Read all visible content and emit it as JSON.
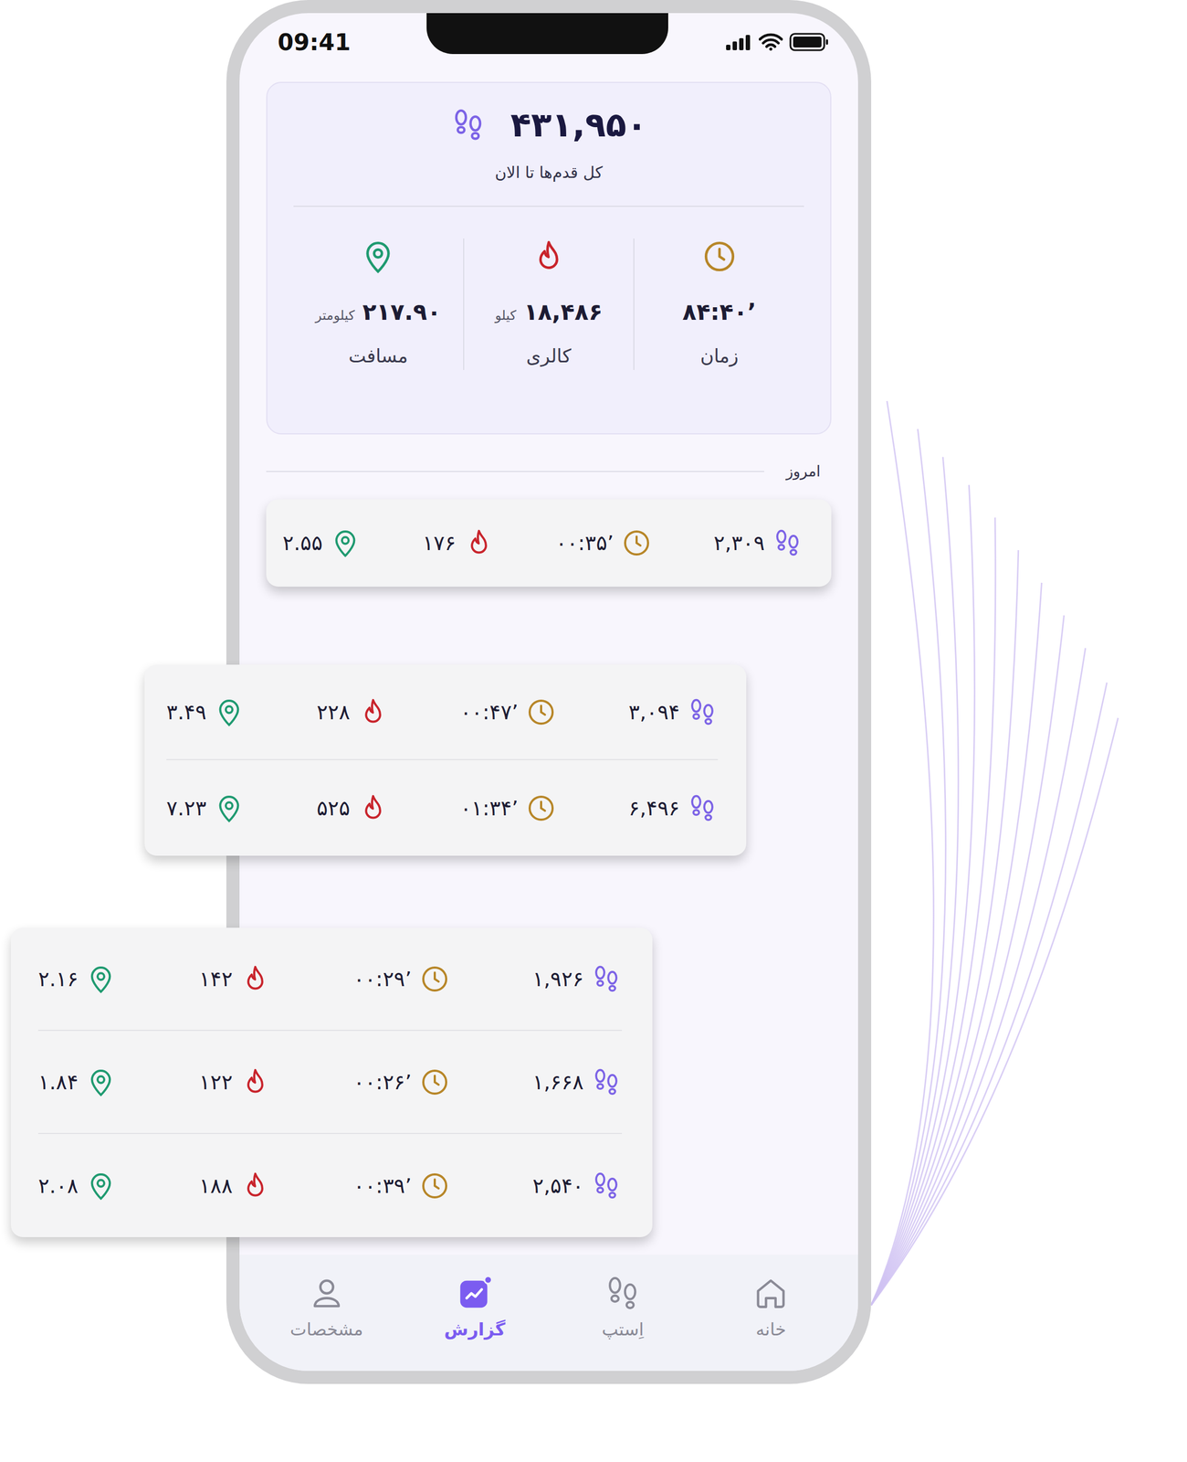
{
  "status_bar": {
    "time": "09:41"
  },
  "summary": {
    "total_steps": "۴۳۱,۹۵۰",
    "total_label": "کل قدم‌ها تا الان",
    "stats": [
      {
        "kind": "time",
        "value": "۸۴:۴۰’",
        "label": "زمان"
      },
      {
        "kind": "calorie",
        "value": "۱۸,۴۸۶",
        "unit": "کیلو",
        "label": "کالری"
      },
      {
        "kind": "distance",
        "value": "۲۱۷.۹۰",
        "unit": "کیلومتر",
        "label": "مسافت"
      }
    ]
  },
  "today": {
    "label": "امروز",
    "rows": [
      {
        "steps": "۲,۳۰۹",
        "time": "۰۰:۳۵’",
        "calories": "۱۷۶",
        "distance": "۲.۵۵"
      }
    ]
  },
  "floating_cards": [
    {
      "rows": [
        {
          "steps": "۳,۰۹۴",
          "time": "۰۰:۴۷’",
          "calories": "۲۲۸",
          "distance": "۳.۴۹"
        },
        {
          "steps": "۶,۴۹۶",
          "time": "۰۱:۳۴’",
          "calories": "۵۲۵",
          "distance": "۷.۲۳"
        }
      ]
    },
    {
      "rows": [
        {
          "steps": "۱,۹۲۶",
          "time": "۰۰:۲۹’",
          "calories": "۱۴۲",
          "distance": "۲.۱۶"
        },
        {
          "steps": "۱,۶۶۸",
          "time": "۰۰:۲۶’",
          "calories": "۱۲۲",
          "distance": "۱.۸۴"
        },
        {
          "steps": "۲,۵۴۰",
          "time": "۰۰:۳۹’",
          "calories": "۱۸۸",
          "distance": "۲.۰۸"
        }
      ]
    }
  ],
  "nav": [
    {
      "label": "خانه",
      "kind": "home",
      "selected": false
    },
    {
      "label": "اِستپ",
      "kind": "steps",
      "selected": false
    },
    {
      "label": "گزارش",
      "kind": "report",
      "selected": true
    },
    {
      "label": "مشخصات",
      "kind": "profile",
      "selected": false
    }
  ]
}
